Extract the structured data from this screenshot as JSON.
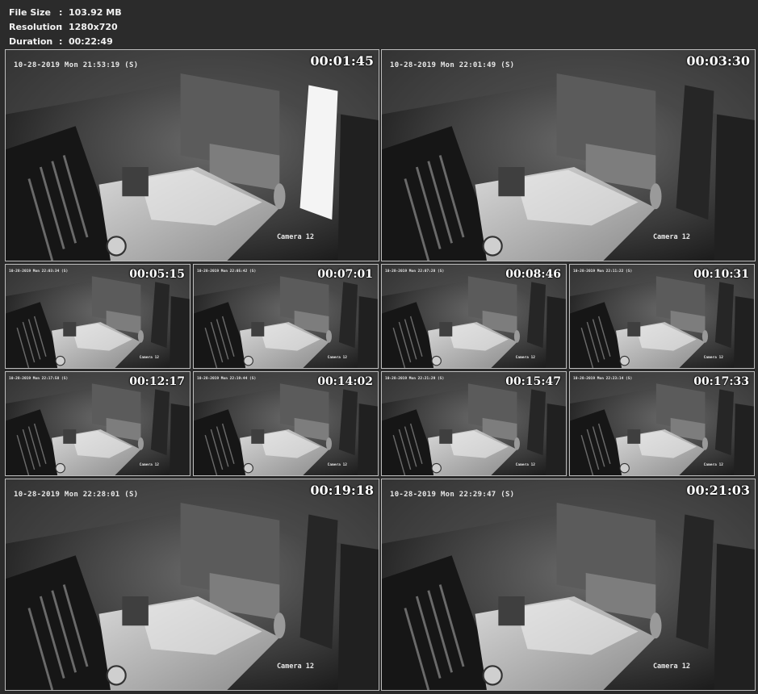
{
  "file_info": {
    "file_size_label": "File Size",
    "file_size_value": "103.92 MB",
    "resolution_label": "Resolution",
    "resolution_value": "1280x720",
    "duration_label": "Duration",
    "duration_value": "00:22:49",
    "separator": ":"
  },
  "thumbnails": [
    {
      "timestamp": "00:01:45",
      "osd": "10-28-2019 Mon 21:53:19 (S)",
      "camera": "Camera 12"
    },
    {
      "timestamp": "00:03:30",
      "osd": "10-28-2019 Mon 22:01:49 (S)",
      "camera": "Camera 12"
    },
    {
      "timestamp": "00:05:15",
      "osd": "10-28-2019 Mon 22:03:34 (S)",
      "camera": "Camera 12"
    },
    {
      "timestamp": "00:07:01",
      "osd": "10-28-2019 Mon 22:05:42 (S)",
      "camera": "Camera 12"
    },
    {
      "timestamp": "00:08:46",
      "osd": "10-28-2019 Mon 22:07:28 (S)",
      "camera": "Camera 12"
    },
    {
      "timestamp": "00:10:31",
      "osd": "10-28-2019 Mon 22:11:22 (S)",
      "camera": "Camera 12"
    },
    {
      "timestamp": "00:12:17",
      "osd": "10-28-2019 Mon 22:17:58 (S)",
      "camera": "Camera 12"
    },
    {
      "timestamp": "00:14:02",
      "osd": "10-28-2019 Mon 22:19:44 (S)",
      "camera": "Camera 12"
    },
    {
      "timestamp": "00:15:47",
      "osd": "10-28-2019 Mon 22:21:29 (S)",
      "camera": "Camera 12"
    },
    {
      "timestamp": "00:17:33",
      "osd": "10-28-2019 Mon 22:23:14 (S)",
      "camera": "Camera 12"
    },
    {
      "timestamp": "00:19:18",
      "osd": "10-28-2019 Mon 22:28:01 (S)",
      "camera": "Camera 12"
    },
    {
      "timestamp": "00:21:03",
      "osd": "10-28-2019 Mon 22:29:47 (S)",
      "camera": "Camera 12"
    }
  ]
}
